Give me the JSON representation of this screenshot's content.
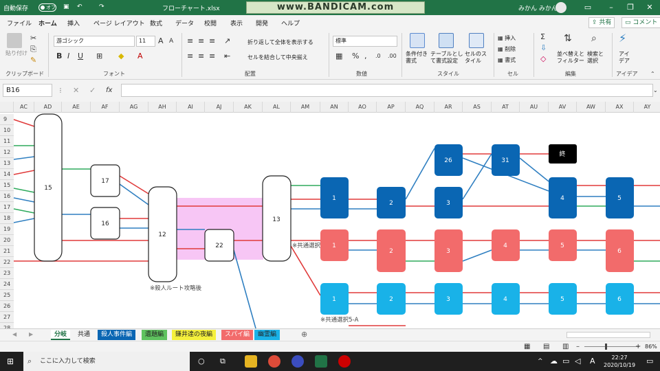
{
  "titlebar": {
    "autosave": "自動保存",
    "autosave_state": "オフ",
    "filename": "フローチャート.xlsx",
    "watermark": "www.BANDICAM.com",
    "user": "みかん みかん"
  },
  "menu": {
    "tabs": [
      "ファイル",
      "ホーム",
      "挿入",
      "ページ レイアウト",
      "数式",
      "データ",
      "校閲",
      "表示",
      "開発",
      "ヘルプ"
    ],
    "share": "共有",
    "comment": "コメント"
  },
  "ribbon": {
    "clipboard": {
      "paste": "貼り付け",
      "label": "クリップボード"
    },
    "font": {
      "name": "游ゴシック",
      "size": "11",
      "label": "フォント",
      "bold": "B",
      "italic": "I",
      "underline": "U"
    },
    "align": {
      "wrap": "折り返して全体を表示する",
      "merge": "セルを結合して中央揃え",
      "label": "配置"
    },
    "number": {
      "format": "標準",
      "label": "数値"
    },
    "style": {
      "cond": "条件付き書式",
      "table": "テーブルとして書式設定",
      "cell": "セルのスタイル",
      "label": "スタイル"
    },
    "cells": {
      "insert": "挿入",
      "delete": "削除",
      "format": "書式",
      "label": "セル"
    },
    "edit": {
      "sort": "並べ替えとフィルター",
      "find": "検索と選択",
      "label": "編集"
    },
    "idea": {
      "btn": "アイデア",
      "label": "アイデア"
    }
  },
  "formula": {
    "namebox": "B16",
    "value": ""
  },
  "columns": [
    "AC",
    "AD",
    "AE",
    "AF",
    "AG",
    "AH",
    "AI",
    "AJ",
    "AK",
    "AL",
    "AM",
    "AN",
    "AO",
    "AP",
    "AQ",
    "AR",
    "AS",
    "AT",
    "AU",
    "AV",
    "AW",
    "AX",
    "AY"
  ],
  "rows": [
    "9",
    "10",
    "11",
    "12",
    "13",
    "14",
    "15",
    "16",
    "17",
    "18",
    "19",
    "20",
    "21",
    "22",
    "23",
    "24",
    "25",
    "26",
    "27",
    "28"
  ],
  "nodes": {
    "n15": "15",
    "n17": "17",
    "n16": "16",
    "n12": "12",
    "n22": "22",
    "n13": "13",
    "b1": "1",
    "b2": "2",
    "b26": "26",
    "b3": "3",
    "b31": "31",
    "end": "終",
    "b4": "4",
    "b5": "5",
    "r1": "1",
    "r2": "2",
    "r3": "3",
    "r4": "4",
    "r5": "5",
    "r6": "6",
    "c1": "1",
    "c2": "2",
    "c3": "3",
    "c4": "4",
    "c5": "5",
    "c6": "6"
  },
  "notes": {
    "after_kill": "※殺人ルート攻略後",
    "common_a": "※共通選択",
    "common_b": "※共通選択5-A"
  },
  "sheets": [
    "分岐",
    "共通",
    "殺人事件編",
    "遺題編",
    "鎌井達の夜編",
    "スパイ編",
    "幽霊編"
  ],
  "status": {
    "zoom": "86%"
  },
  "taskbar": {
    "search": "ここに入力して検索",
    "time": "22:27",
    "date": "2020/10/19",
    "ime": "A"
  },
  "colors": {
    "excel": "#217346",
    "blue": "#0a66b3",
    "red": "#f26b6b",
    "cyan": "#19b2e8",
    "pink": "#f7c6f5",
    "line_red": "#e03a3a",
    "line_blue": "#2f7fc1",
    "line_green": "#2eaa5c"
  }
}
